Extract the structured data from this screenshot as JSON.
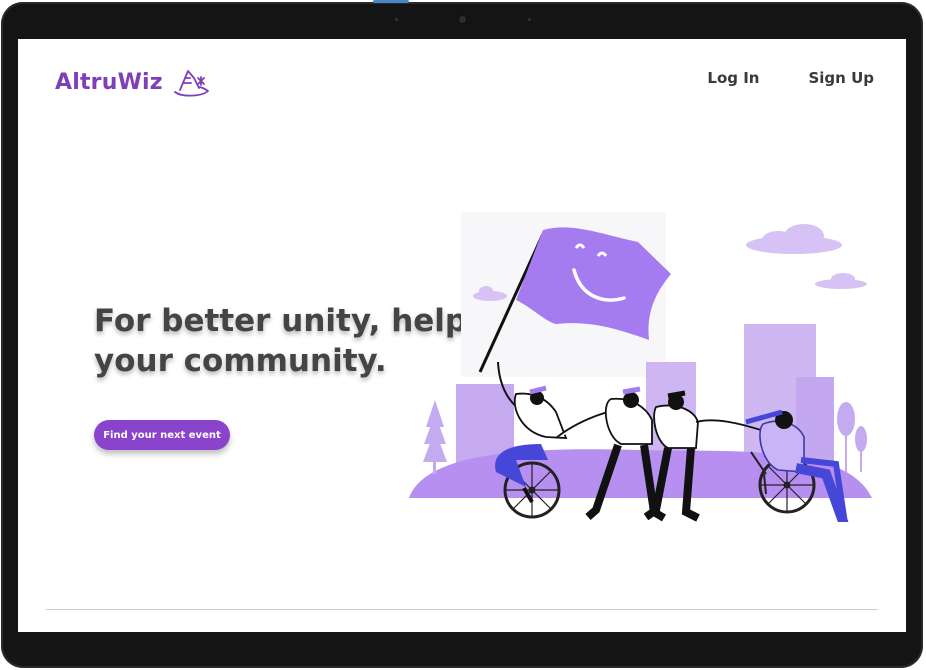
{
  "brand": {
    "name": "AltruWiz",
    "color": "#7e3fb8",
    "icon": "wizard-hat-icon"
  },
  "nav": {
    "login_label": "Log In",
    "signup_label": "Sign Up"
  },
  "hero": {
    "title": "For better unity, help your community.",
    "cta_label": "Find your next event",
    "cta_color": "#8a44cc"
  },
  "illustration": {
    "subject": "community-flag-illustration",
    "accent": "#a57cf0",
    "wheel": "#222222"
  }
}
